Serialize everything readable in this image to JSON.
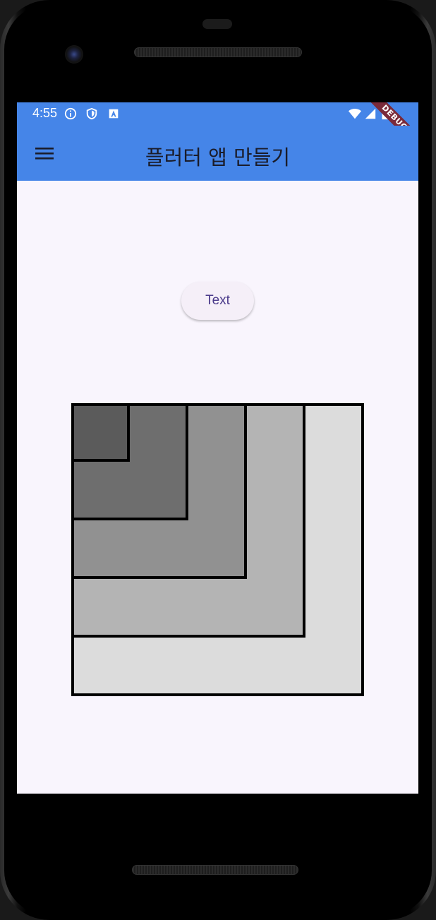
{
  "status_bar": {
    "time": "4:55",
    "icons": [
      "info-icon",
      "shield-icon",
      "a-box-icon",
      "wifi-icon",
      "cellular-icon",
      "battery-icon"
    ]
  },
  "app_bar": {
    "title": "플러터 앱 만들기",
    "menu_icon": "hamburger-menu-icon",
    "background": "#4585e8",
    "debug_label": "DEBUG"
  },
  "main": {
    "button_label": "Text",
    "nested_boxes": {
      "count": 5,
      "fills": [
        "#dcdcdc",
        "#b4b4b4",
        "#919191",
        "#6e6e6e",
        "#5b5b5b"
      ],
      "border_color": "#000000"
    }
  }
}
